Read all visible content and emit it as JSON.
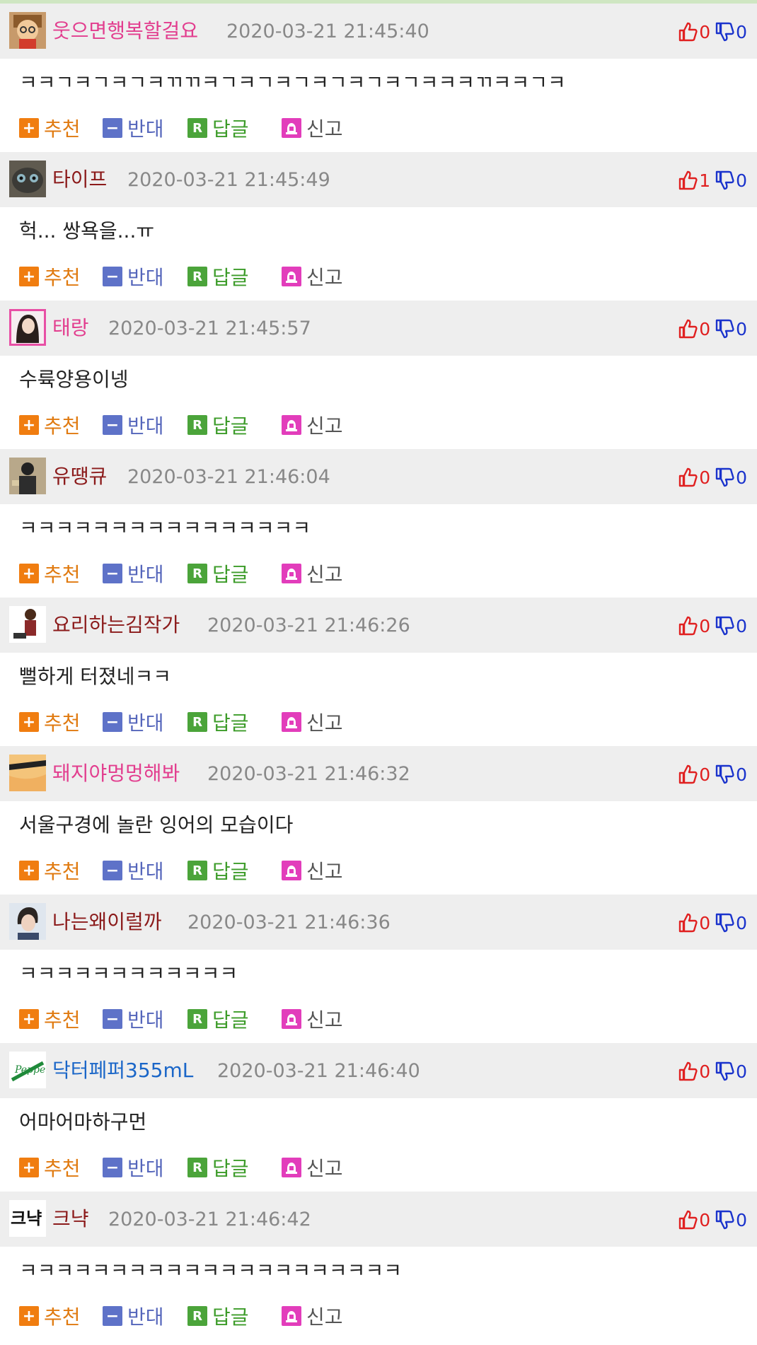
{
  "actions": {
    "recommend": "추천",
    "oppose": "반대",
    "reply": "답글",
    "report": "신고"
  },
  "colors": {
    "header_bg": "#eeeeee",
    "up_count": "#e02020",
    "down_count": "#1a33cc",
    "recommend": "#f07d10",
    "oppose": "#5e72c8",
    "reply": "#4ba43a",
    "report": "#e23dbb"
  },
  "comments": [
    {
      "nick": "웃으면행복할걸요",
      "nick_color": "#e23d8e",
      "time": "2020-03-21 21:45:40",
      "up": "0",
      "down": "0",
      "body": "ㅋㅋㄱㅋㄱㅋㄱㅋㄲㄲㅋㄱㅋㄱㅋㄱㅋㄱㅋㄱㅋㄱㅋㅋㅋㄲㅋㅋㄱㅋ",
      "avatar": "cartoon-face"
    },
    {
      "nick": "타이프",
      "nick_color": "#8b1a1a",
      "time": "2020-03-21 21:45:49",
      "up": "1",
      "down": "0",
      "body": "헉... 쌍욕을...ㅠ",
      "avatar": "cat-photo"
    },
    {
      "nick": "태랑",
      "nick_color": "#e23d8e",
      "time": "2020-03-21 21:45:57",
      "up": "0",
      "down": "0",
      "body": "수륙양용이넹",
      "avatar": "woman-portrait"
    },
    {
      "nick": "유땡큐",
      "nick_color": "#8b1a1a",
      "time": "2020-03-21 21:46:04",
      "up": "0",
      "down": "0",
      "body": "ㅋㅋㅋㅋㅋㅋㅋㅋㅋㅋㅋㅋㅋㅋㅋㅋ",
      "avatar": "figure-photo"
    },
    {
      "nick": "요리하는김작가",
      "nick_color": "#8b1a1a",
      "time": "2020-03-21 21:46:26",
      "up": "0",
      "down": "0",
      "body": "뻘하게 터졌네ㅋㅋ",
      "avatar": "cartoon-character"
    },
    {
      "nick": "돼지야멍멍해봐",
      "nick_color": "#e23d8e",
      "time": "2020-03-21 21:46:32",
      "up": "0",
      "down": "0",
      "body": "서울구경에 놀란 잉어의 모습이다",
      "avatar": "cartoon-eye"
    },
    {
      "nick": "나는왜이럴까",
      "nick_color": "#8b1a1a",
      "time": "2020-03-21 21:46:36",
      "up": "0",
      "down": "0",
      "body": "ㅋㅋㅋㅋㅋㅋㅋㅋㅋㅋㅋㅋ",
      "avatar": "man-portrait"
    },
    {
      "nick": "닥터페퍼355mL",
      "nick_color": "#1a66c8",
      "time": "2020-03-21 21:46:40",
      "up": "0",
      "down": "0",
      "body": "어마어마하구먼",
      "avatar": "dr-pepper-logo"
    },
    {
      "nick": "크냑",
      "nick_color": "#8b1a1a",
      "time": "2020-03-21 21:46:42",
      "up": "0",
      "down": "0",
      "body": "ㅋㅋㅋㅋㅋㅋㅋㅋㅋㅋㅋㅋㅋㅋㅋㅋㅋㅋㅋㅋㅋ",
      "avatar": "text-logo"
    }
  ]
}
